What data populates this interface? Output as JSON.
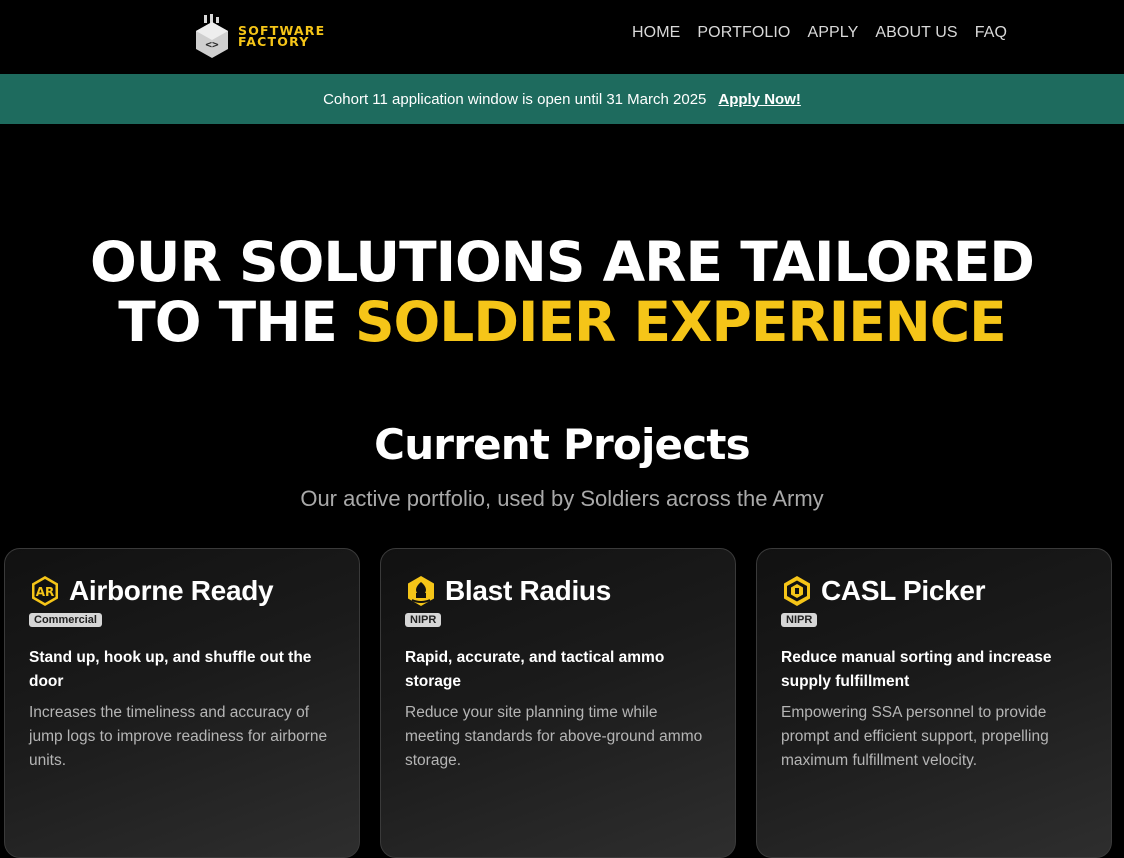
{
  "header": {
    "logo": {
      "line1": "SOFTWARE",
      "line2": "FACTORY"
    },
    "nav": [
      "HOME",
      "PORTFOLIO",
      "APPLY",
      "ABOUT US",
      "FAQ"
    ]
  },
  "banner": {
    "text": "Cohort 11 application window is open until 31 March 2025",
    "link": "Apply Now!"
  },
  "hero": {
    "line1": "OUR SOLUTIONS ARE TAILORED",
    "line2_prefix": "TO THE ",
    "line2_accent": "SOLDIER EXPERIENCE"
  },
  "projects": {
    "title": "Current Projects",
    "subtitle": "Our active portfolio, used by Soldiers across the Army",
    "cards": [
      {
        "icon": "airborne-ready-icon",
        "title": "Airborne Ready",
        "badge": "Commercial",
        "tagline": "Stand up, hook up, and shuffle out the door",
        "description": "Increases the timeliness and accuracy of jump logs to improve readiness for airborne units."
      },
      {
        "icon": "blast-radius-icon",
        "title": "Blast Radius",
        "badge": "NIPR",
        "tagline": "Rapid, accurate, and tactical ammo storage",
        "description": "Reduce your site planning time while meeting standards for above-ground ammo storage."
      },
      {
        "icon": "casl-picker-icon",
        "title": "CASL Picker",
        "badge": "NIPR",
        "tagline": "Reduce manual sorting and increase supply fulfillment",
        "description": "Empowering SSA personnel to provide prompt and efficient support, propelling maximum fulfillment velocity."
      }
    ]
  },
  "colors": {
    "accent": "#f5c518",
    "banner": "#1e6b5e",
    "background": "#000000"
  }
}
